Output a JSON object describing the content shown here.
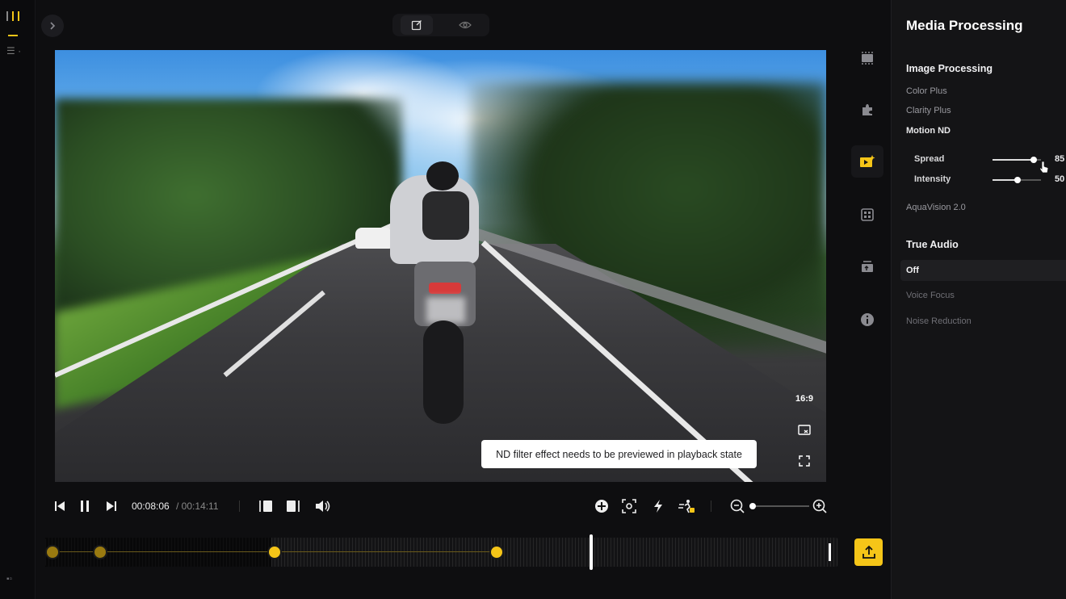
{
  "toolbar": {
    "back_icon": "chevron-right-icon",
    "edit_icon": "edit-square-icon",
    "preview_icon": "eye-icon"
  },
  "video": {
    "aspect_ratio": "16:9",
    "tooltip": "ND filter effect needs to be previewed in playback state",
    "pip_icon": "picture-in-picture-icon",
    "fullscreen_icon": "fullscreen-icon"
  },
  "playback": {
    "current_time": "00:08:06",
    "total_time": "/ 00:14:11",
    "zoom_level": 0.05
  },
  "timeline": {
    "playhead_position": 0.69,
    "export_icon": "upload-icon"
  },
  "rail": {
    "items": [
      {
        "name": "video-clip-icon"
      },
      {
        "name": "plugin-icon"
      },
      {
        "name": "media-ai-icon",
        "active": true
      },
      {
        "name": "template-icon"
      },
      {
        "name": "layers-icon"
      },
      {
        "name": "info-icon"
      }
    ]
  },
  "panel": {
    "title": "Media Processing",
    "image_processing": {
      "heading": "Image Processing",
      "color_plus": "Color Plus",
      "clarity_plus": "Clarity Plus",
      "motion_nd": "Motion ND",
      "spread_label": "Spread",
      "spread_value": "85",
      "intensity_label": "Intensity",
      "intensity_value": "50",
      "aquavision": "AquaVision 2.0"
    },
    "true_audio": {
      "heading": "True Audio",
      "selected": "Off",
      "voice_focus": "Voice Focus",
      "noise_reduction": "Noise Reduction"
    }
  },
  "colors": {
    "accent": "#f5c518",
    "background": "#0e0e10",
    "panel": "#141416"
  }
}
